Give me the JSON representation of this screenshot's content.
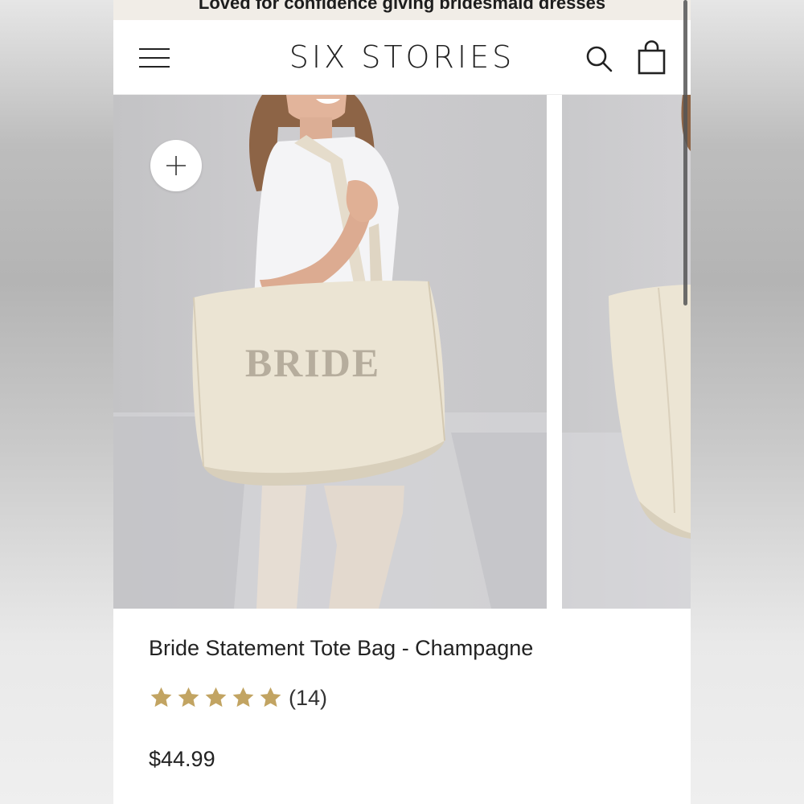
{
  "announcement": {
    "text": "Loved for confidence giving bridesmaid dresses"
  },
  "header": {
    "logo": "SIX STORIES",
    "menu_icon": "hamburger-menu-icon",
    "search_icon": "search-icon",
    "cart_icon": "shopping-bag-icon"
  },
  "gallery": {
    "bag_print": "BRIDE",
    "zoom_icon": "plus-icon"
  },
  "product": {
    "title": "Bride Statement Tote Bag - Champagne",
    "rating_stars": 5,
    "review_count": "(14)",
    "price": "$44.99"
  },
  "colors": {
    "star": "#c2a462",
    "announcement_bg": "#f1ede7",
    "text": "#222222"
  }
}
